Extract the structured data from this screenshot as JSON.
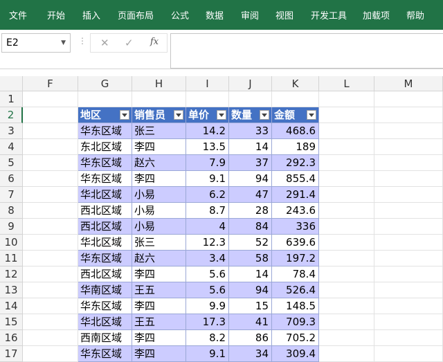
{
  "ribbon_tabs": [
    "文件",
    "开始",
    "插入",
    "页面布局",
    "公式",
    "数据",
    "审阅",
    "视图",
    "开发工具",
    "加载项",
    "帮助"
  ],
  "name_box": "E2",
  "formula_icons": {
    "cancel": "✕",
    "enter": "✓",
    "fx": "fx"
  },
  "columns": [
    "F",
    "G",
    "H",
    "I",
    "J",
    "K",
    "L",
    "M"
  ],
  "rows": [
    "1",
    "2",
    "3",
    "4",
    "5",
    "6",
    "7",
    "8",
    "9",
    "10",
    "11",
    "12",
    "13",
    "14",
    "15",
    "16",
    "17"
  ],
  "table": {
    "headers": [
      "地区",
      "销售员",
      "单价",
      "数量",
      "金额"
    ],
    "rows": [
      [
        "华东区域",
        "张三",
        "14.2",
        "33",
        "468.6"
      ],
      [
        "东北区域",
        "李四",
        "13.5",
        "14",
        "189"
      ],
      [
        "华东区域",
        "赵六",
        "7.9",
        "37",
        "292.3"
      ],
      [
        "华东区域",
        "李四",
        "9.1",
        "94",
        "855.4"
      ],
      [
        "华北区域",
        "小易",
        "6.2",
        "47",
        "291.4"
      ],
      [
        "西北区域",
        "小易",
        "8.7",
        "28",
        "243.6"
      ],
      [
        "西北区域",
        "小易",
        "4",
        "84",
        "336"
      ],
      [
        "华北区域",
        "张三",
        "12.3",
        "52",
        "639.6"
      ],
      [
        "华东区域",
        "赵六",
        "3.4",
        "58",
        "197.2"
      ],
      [
        "西北区域",
        "李四",
        "5.6",
        "14",
        "78.4"
      ],
      [
        "华南区域",
        "王五",
        "5.6",
        "94",
        "526.4"
      ],
      [
        "华东区域",
        "李四",
        "9.9",
        "15",
        "148.5"
      ],
      [
        "华北区域",
        "王五",
        "17.3",
        "41",
        "709.3"
      ],
      [
        "西南区域",
        "李四",
        "8.2",
        "86",
        "705.2"
      ],
      [
        "华东区域",
        "李四",
        "9.1",
        "34",
        "309.4"
      ]
    ]
  },
  "colors": {
    "ribbon": "#217346",
    "table_header": "#4472c4",
    "band": "#ccccff"
  }
}
